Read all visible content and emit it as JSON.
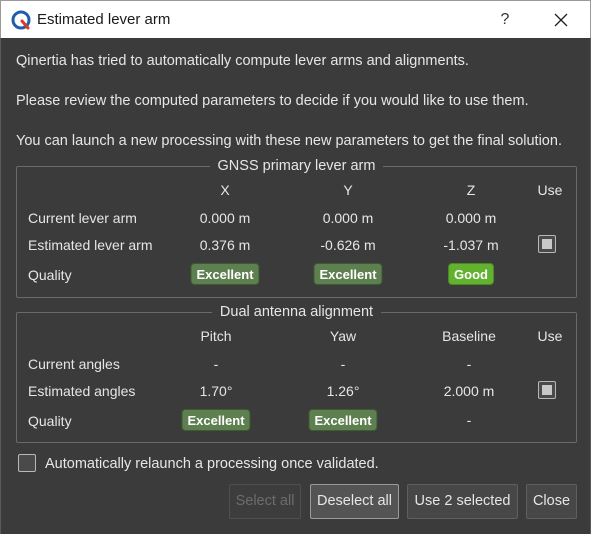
{
  "window": {
    "title": "Estimated lever arm",
    "help_label": "?"
  },
  "messages": [
    "Qinertia has tried to automatically compute lever arms and alignments.",
    "Please review the computed parameters to decide if you would like to use them.",
    "You can launch a new processing with these new parameters to get the final solution."
  ],
  "gnss": {
    "title": "GNSS primary lever arm",
    "headers": [
      "X",
      "Y",
      "Z",
      "Use"
    ],
    "rows": [
      {
        "label": "Current lever arm",
        "values": [
          "0.000 m",
          "0.000 m",
          "0.000 m"
        ]
      },
      {
        "label": "Estimated lever arm",
        "values": [
          "0.376 m",
          "-0.626 m",
          "-1.037 m"
        ]
      }
    ],
    "quality_label": "Quality",
    "quality": [
      "Excellent",
      "Excellent",
      "Good"
    ],
    "use_checked": true
  },
  "dual": {
    "title": "Dual antenna alignment",
    "headers": [
      "Pitch",
      "Yaw",
      "Baseline",
      "Use"
    ],
    "rows": [
      {
        "label": "Current angles",
        "values": [
          "-",
          "-",
          "-"
        ]
      },
      {
        "label": "Estimated angles",
        "values": [
          "1.70°",
          "1.26°",
          "2.000 m"
        ]
      }
    ],
    "quality_label": "Quality",
    "quality": [
      "Excellent",
      "Excellent",
      "-"
    ],
    "use_checked": true
  },
  "auto_relaunch": {
    "label": "Automatically relaunch a processing once validated.",
    "checked": false
  },
  "buttons": {
    "select_all": "Select all",
    "deselect_all": "Deselect all",
    "use_selected": "Use 2 selected",
    "close": "Close"
  },
  "colors": {
    "excellent": "#5e7f4f",
    "good": "#62b22f",
    "background": "#3b3b3b"
  }
}
